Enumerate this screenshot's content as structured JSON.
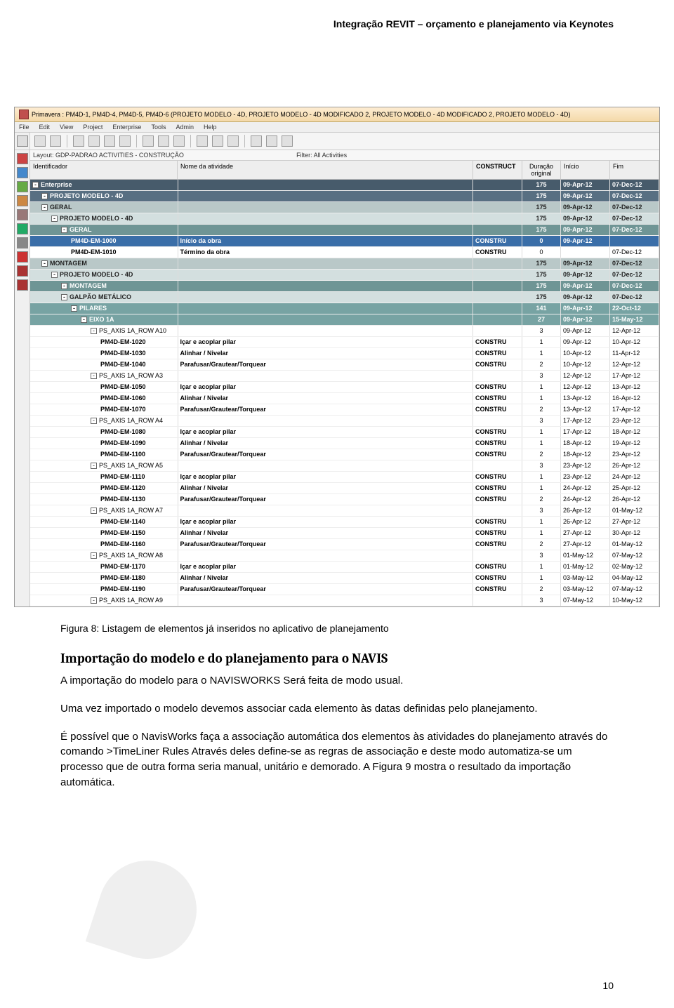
{
  "doc": {
    "header": "Integração REVIT – orçamento e planejamento via Keynotes",
    "caption": "Figura 8: Listagem de elementos já inseridos no aplicativo de planejamento",
    "section_title": "Importação do modelo e do planejamento para o NAVIS",
    "para1": "A importação do modelo para o NAVISWORKS Será feita de modo usual.",
    "para2": "Uma vez importado o modelo devemos associar cada elemento às datas definidas pelo planejamento.",
    "para3": "É possível que o NavisWorks faça a associação automática dos elementos às atividades do planejamento através do comando >TimeLiner Rules Através deles define-se as regras de associação e deste modo  automatiza-se um processo que de outra forma seria manual, unitário e demorado. A Figura 9  mostra o resultado da importação automática.",
    "page_num": "10"
  },
  "app": {
    "title": "Primavera : PM4D-1, PM4D-4, PM4D-5, PM4D-6 (PROJETO MODELO - 4D, PROJETO MODELO - 4D MODIFICADO 2, PROJETO MODELO - 4D MODIFICADO 2, PROJETO MODELO - 4D)",
    "menu": [
      "File",
      "Edit",
      "View",
      "Project",
      "Enterprise",
      "Tools",
      "Admin",
      "Help"
    ],
    "layout_label": "Layout: GDP-PADRAO ACTIVITIES - CONSTRUÇÃO",
    "filter_label": "Filter: All Activities",
    "cols": {
      "id": "Identificador",
      "name": "Nome da atividade",
      "con": "CONSTRUCT",
      "dur": "Duração original",
      "ini": "Início",
      "fim": "Fim"
    },
    "rows": [
      {
        "type": "band-dark",
        "id": "Enterprise",
        "name": "",
        "con": "",
        "dur": "175",
        "ini": "09-Apr-12",
        "fim": "07-Dec-12",
        "ind": 0,
        "exp": "-"
      },
      {
        "type": "band-dark2",
        "id": "PROJETO MODELO - 4D",
        "name": "",
        "con": "",
        "dur": "175",
        "ini": "09-Apr-12",
        "fim": "07-Dec-12",
        "ind": 1,
        "exp": "-"
      },
      {
        "type": "band-gray",
        "id": "GERAL",
        "name": "",
        "con": "",
        "dur": "175",
        "ini": "09-Apr-12",
        "fim": "07-Dec-12",
        "ind": 1,
        "exp": "-"
      },
      {
        "type": "band-mid",
        "id": "PROJETO MODELO - 4D",
        "name": "",
        "con": "",
        "dur": "175",
        "ini": "09-Apr-12",
        "fim": "07-Dec-12",
        "ind": 2,
        "exp": "-"
      },
      {
        "type": "band-teal",
        "id": "GERAL",
        "name": "",
        "con": "",
        "dur": "175",
        "ini": "09-Apr-12",
        "fim": "07-Dec-12",
        "ind": 3,
        "exp": "-"
      },
      {
        "type": "band-hl",
        "id": "PM4D-EM-1000",
        "name": "Início da obra",
        "con": "CONSTRU",
        "dur": "0",
        "ini": "09-Apr-12",
        "fim": "",
        "ind": 4,
        "bold": true
      },
      {
        "type": "",
        "id": "PM4D-EM-1010",
        "name": "Término da obra",
        "con": "CONSTRU",
        "dur": "0",
        "ini": "",
        "fim": "07-Dec-12",
        "ind": 4,
        "bold": true
      },
      {
        "type": "band-gray",
        "id": "MONTAGEM",
        "name": "",
        "con": "",
        "dur": "175",
        "ini": "09-Apr-12",
        "fim": "07-Dec-12",
        "ind": 1,
        "exp": "-"
      },
      {
        "type": "band-mid",
        "id": "PROJETO MODELO - 4D",
        "name": "",
        "con": "",
        "dur": "175",
        "ini": "09-Apr-12",
        "fim": "07-Dec-12",
        "ind": 2,
        "exp": "-"
      },
      {
        "type": "band-teal",
        "id": "MONTAGEM",
        "name": "",
        "con": "",
        "dur": "175",
        "ini": "09-Apr-12",
        "fim": "07-Dec-12",
        "ind": 3,
        "exp": "-"
      },
      {
        "type": "band-mid",
        "id": "GALPÃO METÁLICO",
        "name": "",
        "con": "",
        "dur": "175",
        "ini": "09-Apr-12",
        "fim": "07-Dec-12",
        "ind": 3,
        "exp": "-"
      },
      {
        "type": "band-teal2",
        "id": "PILARES",
        "name": "",
        "con": "",
        "dur": "141",
        "ini": "09-Apr-12",
        "fim": "22-Oct-12",
        "ind": 4,
        "exp": "-"
      },
      {
        "type": "band-teal2",
        "id": "EIXO 1A",
        "name": "",
        "con": "",
        "dur": "27",
        "ini": "09-Apr-12",
        "fim": "15-May-12",
        "ind": 5,
        "exp": "-"
      },
      {
        "type": "",
        "id": "PS_AXIS 1A_ROW A10",
        "name": "",
        "con": "",
        "dur": "3",
        "ini": "09-Apr-12",
        "fim": "12-Apr-12",
        "ind": 6,
        "exp": "-"
      },
      {
        "type": "",
        "id": "PM4D-EM-1020",
        "name": "Içar e acoplar pilar",
        "con": "CONSTRU",
        "dur": "1",
        "ini": "09-Apr-12",
        "fim": "10-Apr-12",
        "ind": 7,
        "bold": true
      },
      {
        "type": "",
        "id": "PM4D-EM-1030",
        "name": "Alinhar / Nivelar",
        "con": "CONSTRU",
        "dur": "1",
        "ini": "10-Apr-12",
        "fim": "11-Apr-12",
        "ind": 7,
        "bold": true
      },
      {
        "type": "",
        "id": "PM4D-EM-1040",
        "name": "Parafusar/Grautear/Torquear",
        "con": "CONSTRU",
        "dur": "2",
        "ini": "10-Apr-12",
        "fim": "12-Apr-12",
        "ind": 7,
        "bold": true
      },
      {
        "type": "",
        "id": "PS_AXIS 1A_ROW A3",
        "name": "",
        "con": "",
        "dur": "3",
        "ini": "12-Apr-12",
        "fim": "17-Apr-12",
        "ind": 6,
        "exp": "-"
      },
      {
        "type": "",
        "id": "PM4D-EM-1050",
        "name": "Içar e acoplar pilar",
        "con": "CONSTRU",
        "dur": "1",
        "ini": "12-Apr-12",
        "fim": "13-Apr-12",
        "ind": 7,
        "bold": true
      },
      {
        "type": "",
        "id": "PM4D-EM-1060",
        "name": "Alinhar / Nivelar",
        "con": "CONSTRU",
        "dur": "1",
        "ini": "13-Apr-12",
        "fim": "16-Apr-12",
        "ind": 7,
        "bold": true
      },
      {
        "type": "",
        "id": "PM4D-EM-1070",
        "name": "Parafusar/Grautear/Torquear",
        "con": "CONSTRU",
        "dur": "2",
        "ini": "13-Apr-12",
        "fim": "17-Apr-12",
        "ind": 7,
        "bold": true
      },
      {
        "type": "",
        "id": "PS_AXIS 1A_ROW A4",
        "name": "",
        "con": "",
        "dur": "3",
        "ini": "17-Apr-12",
        "fim": "23-Apr-12",
        "ind": 6,
        "exp": "-"
      },
      {
        "type": "",
        "id": "PM4D-EM-1080",
        "name": "Içar e acoplar pilar",
        "con": "CONSTRU",
        "dur": "1",
        "ini": "17-Apr-12",
        "fim": "18-Apr-12",
        "ind": 7,
        "bold": true
      },
      {
        "type": "",
        "id": "PM4D-EM-1090",
        "name": "Alinhar / Nivelar",
        "con": "CONSTRU",
        "dur": "1",
        "ini": "18-Apr-12",
        "fim": "19-Apr-12",
        "ind": 7,
        "bold": true
      },
      {
        "type": "",
        "id": "PM4D-EM-1100",
        "name": "Parafusar/Grautear/Torquear",
        "con": "CONSTRU",
        "dur": "2",
        "ini": "18-Apr-12",
        "fim": "23-Apr-12",
        "ind": 7,
        "bold": true
      },
      {
        "type": "",
        "id": "PS_AXIS 1A_ROW A5",
        "name": "",
        "con": "",
        "dur": "3",
        "ini": "23-Apr-12",
        "fim": "26-Apr-12",
        "ind": 6,
        "exp": "-"
      },
      {
        "type": "",
        "id": "PM4D-EM-1110",
        "name": "Içar e acoplar pilar",
        "con": "CONSTRU",
        "dur": "1",
        "ini": "23-Apr-12",
        "fim": "24-Apr-12",
        "ind": 7,
        "bold": true
      },
      {
        "type": "",
        "id": "PM4D-EM-1120",
        "name": "Alinhar / Nivelar",
        "con": "CONSTRU",
        "dur": "1",
        "ini": "24-Apr-12",
        "fim": "25-Apr-12",
        "ind": 7,
        "bold": true
      },
      {
        "type": "",
        "id": "PM4D-EM-1130",
        "name": "Parafusar/Grautear/Torquear",
        "con": "CONSTRU",
        "dur": "2",
        "ini": "24-Apr-12",
        "fim": "26-Apr-12",
        "ind": 7,
        "bold": true
      },
      {
        "type": "",
        "id": "PS_AXIS 1A_ROW A7",
        "name": "",
        "con": "",
        "dur": "3",
        "ini": "26-Apr-12",
        "fim": "01-May-12",
        "ind": 6,
        "exp": "-"
      },
      {
        "type": "",
        "id": "PM4D-EM-1140",
        "name": "Içar e acoplar pilar",
        "con": "CONSTRU",
        "dur": "1",
        "ini": "26-Apr-12",
        "fim": "27-Apr-12",
        "ind": 7,
        "bold": true
      },
      {
        "type": "",
        "id": "PM4D-EM-1150",
        "name": "Alinhar / Nivelar",
        "con": "CONSTRU",
        "dur": "1",
        "ini": "27-Apr-12",
        "fim": "30-Apr-12",
        "ind": 7,
        "bold": true
      },
      {
        "type": "",
        "id": "PM4D-EM-1160",
        "name": "Parafusar/Grautear/Torquear",
        "con": "CONSTRU",
        "dur": "2",
        "ini": "27-Apr-12",
        "fim": "01-May-12",
        "ind": 7,
        "bold": true
      },
      {
        "type": "",
        "id": "PS_AXIS 1A_ROW A8",
        "name": "",
        "con": "",
        "dur": "3",
        "ini": "01-May-12",
        "fim": "07-May-12",
        "ind": 6,
        "exp": "-"
      },
      {
        "type": "",
        "id": "PM4D-EM-1170",
        "name": "Içar e acoplar pilar",
        "con": "CONSTRU",
        "dur": "1",
        "ini": "01-May-12",
        "fim": "02-May-12",
        "ind": 7,
        "bold": true
      },
      {
        "type": "",
        "id": "PM4D-EM-1180",
        "name": "Alinhar / Nivelar",
        "con": "CONSTRU",
        "dur": "1",
        "ini": "03-May-12",
        "fim": "04-May-12",
        "ind": 7,
        "bold": true
      },
      {
        "type": "",
        "id": "PM4D-EM-1190",
        "name": "Parafusar/Grautear/Torquear",
        "con": "CONSTRU",
        "dur": "2",
        "ini": "03-May-12",
        "fim": "07-May-12",
        "ind": 7,
        "bold": true
      },
      {
        "type": "",
        "id": "PS_AXIS 1A_ROW A9",
        "name": "",
        "con": "",
        "dur": "3",
        "ini": "07-May-12",
        "fim": "10-May-12",
        "ind": 6,
        "exp": "-"
      }
    ]
  }
}
